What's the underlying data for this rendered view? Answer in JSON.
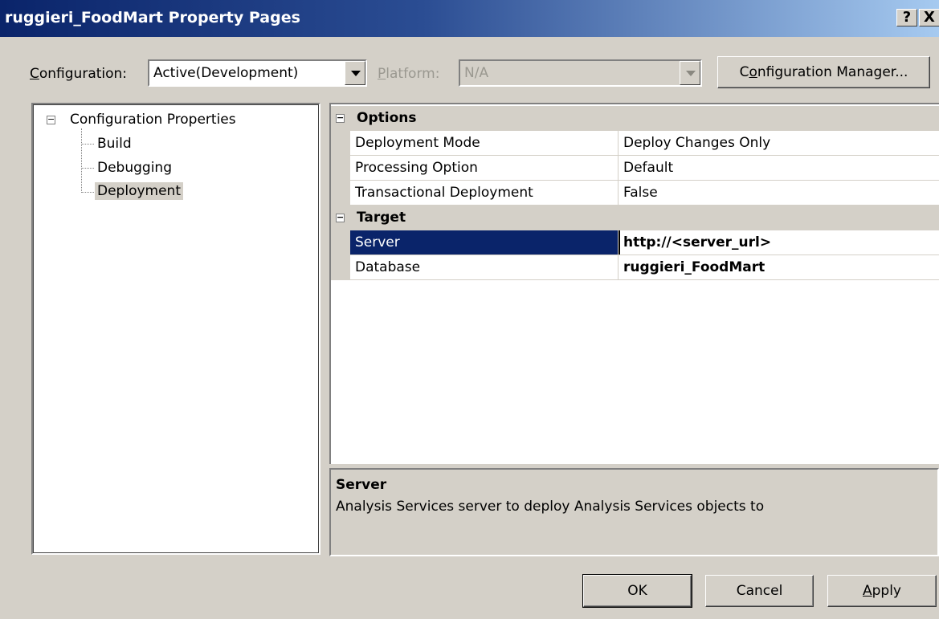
{
  "window": {
    "title": "ruggieri_FoodMart Property Pages",
    "help_label": "?",
    "close_label": "X"
  },
  "toolbar": {
    "configuration_label_prefix": "",
    "configuration_label_underlined": "C",
    "configuration_label_rest": "onfiguration:",
    "configuration_value": "Active(Development)",
    "platform_label_underlined": "P",
    "platform_label_rest": "latform:",
    "platform_value": "N/A",
    "config_manager_prefix": "C",
    "config_manager_underlined": "o",
    "config_manager_rest": "nfiguration Manager..."
  },
  "tree": {
    "root": "Configuration Properties",
    "children": [
      "Build",
      "Debugging",
      "Deployment"
    ],
    "selected": "Deployment"
  },
  "grid": {
    "categories": [
      {
        "name": "Options",
        "rows": [
          {
            "property": "Deployment Mode",
            "value": "Deploy Changes Only"
          },
          {
            "property": "Processing Option",
            "value": "Default"
          },
          {
            "property": "Transactional Deployment",
            "value": "False"
          }
        ]
      },
      {
        "name": "Target",
        "rows": [
          {
            "property": "Server",
            "value": "http://<server_url>"
          },
          {
            "property": "Database",
            "value": "ruggieri_FoodMart"
          }
        ]
      }
    ],
    "selected_property": "Server"
  },
  "description": {
    "title": "Server",
    "text": "Analysis Services server to deploy Analysis Services objects to"
  },
  "buttons": {
    "ok": "OK",
    "cancel": "Cancel",
    "apply_underlined": "A",
    "apply_rest": "pply"
  },
  "colors": {
    "dialog_bg": "#d4d0c8",
    "selection": "#0a246a"
  }
}
